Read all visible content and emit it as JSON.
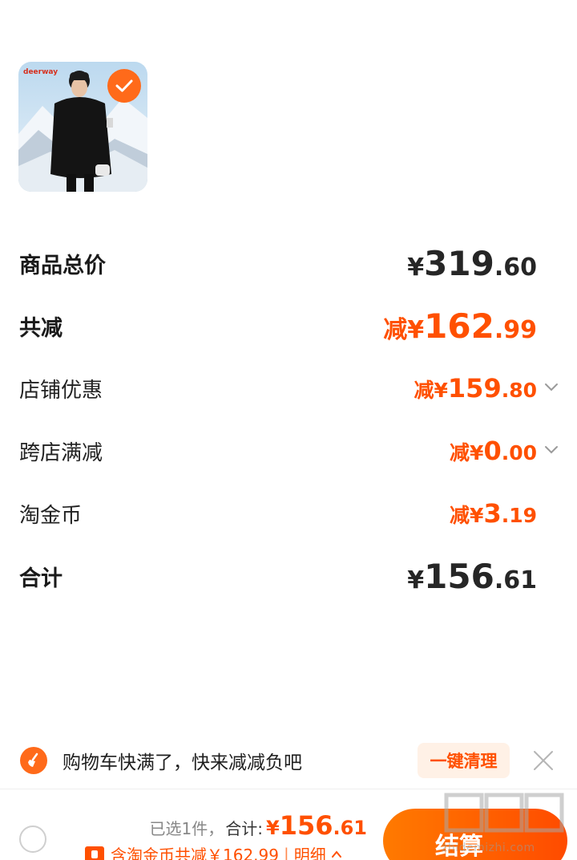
{
  "product": {
    "image_alt": "deerway black puffer jacket",
    "brand_text": "deerway",
    "selected": true
  },
  "summary": {
    "total_price": {
      "label": "商品总价",
      "currency": "¥",
      "int": "319",
      "dec": ".60"
    },
    "total_discount": {
      "label": "共减",
      "prefix": "减",
      "currency": "¥",
      "int": "162",
      "dec": ".99"
    },
    "store_discount": {
      "label": "店铺优惠",
      "prefix": "减",
      "currency": "¥",
      "int": "159",
      "dec": ".80"
    },
    "cross_store": {
      "label": "跨店满减",
      "prefix": "减",
      "currency": "¥",
      "int": "0",
      "dec": ".00"
    },
    "coins": {
      "label": "淘金币",
      "prefix": "减",
      "currency": "¥",
      "int": "3",
      "dec": ".19"
    },
    "grand_total": {
      "label": "合计",
      "currency": "¥",
      "int": "156",
      "dec": ".61"
    }
  },
  "notice": {
    "text": "购物车快满了，快来减减负吧",
    "clear_label": "一键清理"
  },
  "bottom": {
    "selected_text": "已选1件，",
    "sum_label": "合计:",
    "currency": "¥",
    "int": "156",
    "dec": ".61",
    "discount_text": "含淘金币共减￥162.99",
    "detail_label": "明细",
    "checkout_label": "结算"
  },
  "watermark": {
    "text": "zhidemizhi.com"
  },
  "colors": {
    "accent": "#ff5000",
    "badge": "#ff6a1a",
    "text": "#1f1f1f"
  }
}
